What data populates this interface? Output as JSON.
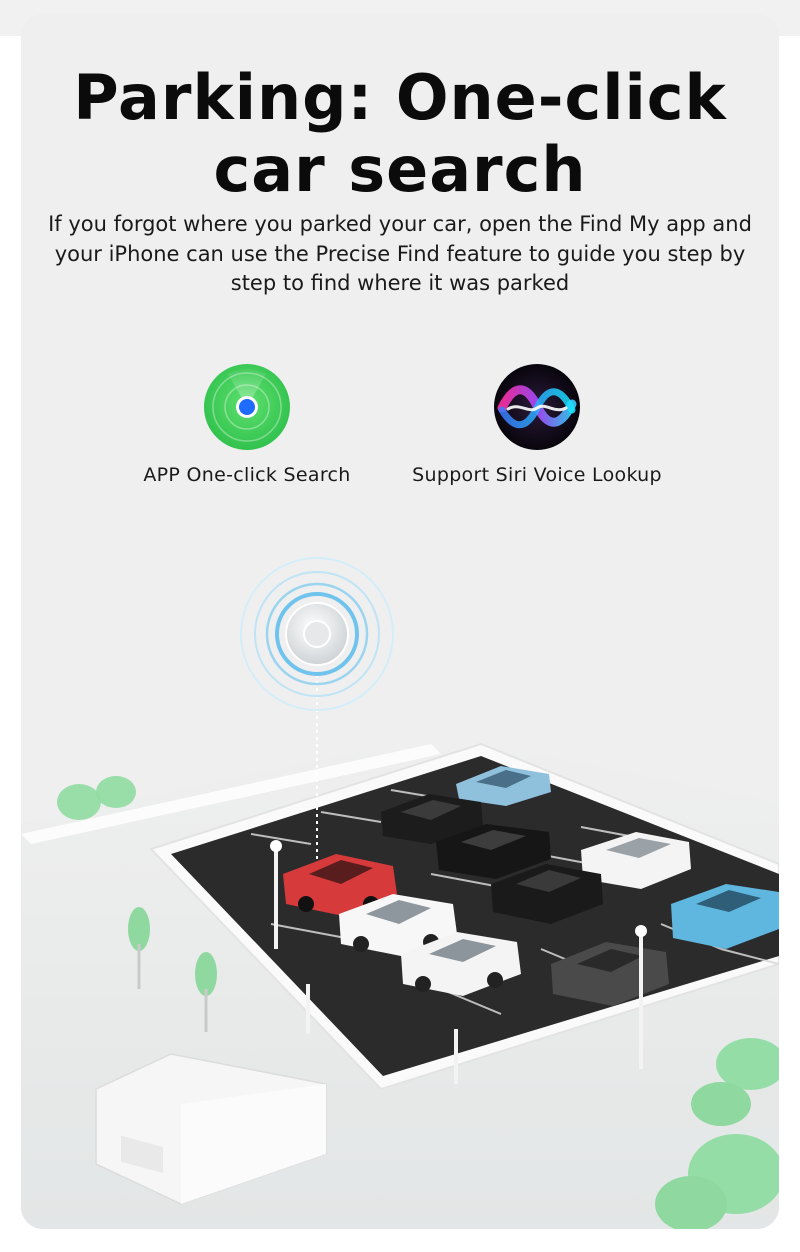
{
  "hero": {
    "title_line1": "Parking: One-click",
    "title_line2": "car search",
    "description_line1": "If you forgot where you parked your car, open the Find My app and",
    "description_line2": "your iPhone can use the Precise Find feature to guide you step by",
    "description_line3": "step to find where it was parked"
  },
  "features": [
    {
      "label": "APP One-click Search",
      "icon": "find-my-radar-icon"
    },
    {
      "label": "Support Siri Voice Lookup",
      "icon": "siri-icon"
    }
  ],
  "scene": {
    "illustration": "isometric-parking-lot",
    "tracker": "airtag-tracker-icon",
    "located_car_color": "#d63a3a"
  },
  "colors": {
    "background": "#efefef",
    "title": "#0b0b0b",
    "find_my_green": "#3fd15a",
    "find_my_blue": "#1e6bff",
    "asphalt": "#2b2b2b",
    "signal_blue": "#6fc3ec"
  }
}
